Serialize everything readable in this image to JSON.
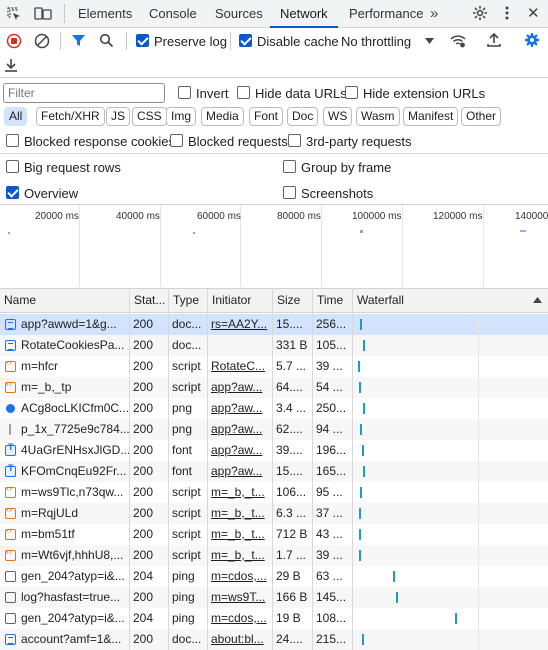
{
  "tabs": [
    "Elements",
    "Console",
    "Sources",
    "Network",
    "Performance"
  ],
  "active_tab": "Network",
  "toolbar": {
    "preserve_log": "Preserve log",
    "disable_cache": "Disable cache",
    "throttling": "No throttling"
  },
  "filter": {
    "placeholder": "Filter",
    "invert": "Invert",
    "hide_data_urls": "Hide data URLs",
    "hide_extension_urls": "Hide extension URLs"
  },
  "chips": [
    "All",
    "Fetch/XHR",
    "JS",
    "CSS",
    "Img",
    "Media",
    "Font",
    "Doc",
    "WS",
    "Wasm",
    "Manifest",
    "Other"
  ],
  "options": {
    "blocked_response_cookies": "Blocked response cookies",
    "blocked_requests": "Blocked requests",
    "third_party": "3rd-party requests",
    "big_rows": "Big request rows",
    "group_by_frame": "Group by frame",
    "overview": "Overview",
    "screenshots": "Screenshots"
  },
  "overview_ticks": [
    "20000 ms",
    "40000 ms",
    "60000 ms",
    "80000 ms",
    "100000 ms",
    "120000 ms",
    "140000"
  ],
  "columns": [
    "Name",
    "Stat...",
    "Type",
    "Initiator",
    "Size",
    "Time",
    "Waterfall"
  ],
  "rows": [
    {
      "name": "app?awwd=1&g...",
      "status": "200",
      "type": "doc...",
      "initiator": "rs=AA2Y...",
      "size": "15....",
      "time": "256...",
      "icon": "doc"
    },
    {
      "name": "RotateCookiesPa...",
      "status": "200",
      "type": "doc...",
      "initiator": "",
      "size": "331 B",
      "time": "105...",
      "icon": "doc"
    },
    {
      "name": "m=hfcr",
      "status": "200",
      "type": "script",
      "initiator": "RotateC...",
      "size": "5.7 ...",
      "time": "39 ...",
      "icon": "script"
    },
    {
      "name": "m=_b,_tp",
      "status": "200",
      "type": "script",
      "initiator": "app?aw...",
      "size": "64....",
      "time": "54 ...",
      "icon": "script"
    },
    {
      "name": "ACg8ocLKICfm0C...",
      "status": "200",
      "type": "png",
      "initiator": "app?aw...",
      "size": "3.4 ...",
      "time": "250...",
      "icon": "img"
    },
    {
      "name": "p_1x_7725e9c784...",
      "status": "200",
      "type": "png",
      "initiator": "app?aw...",
      "size": "62....",
      "time": "94 ...",
      "icon": "bar"
    },
    {
      "name": "4UaGrENHsxJlGD...",
      "status": "200",
      "type": "font",
      "initiator": "app?aw...",
      "size": "39....",
      "time": "196...",
      "icon": "font"
    },
    {
      "name": "KFOmCnqEu92Fr...",
      "status": "200",
      "type": "font",
      "initiator": "app?aw...",
      "size": "15....",
      "time": "165...",
      "icon": "font"
    },
    {
      "name": "m=ws9Tlc,n73qw...",
      "status": "200",
      "type": "script",
      "initiator": "m=_b,_t...",
      "size": "106...",
      "time": "95 ...",
      "icon": "script"
    },
    {
      "name": "m=RqjULd",
      "status": "200",
      "type": "script",
      "initiator": "m=_b,_t...",
      "size": "6.3 ...",
      "time": "37 ...",
      "icon": "script"
    },
    {
      "name": "m=bm51tf",
      "status": "200",
      "type": "script",
      "initiator": "m=_b,_t...",
      "size": "712 B",
      "time": "43 ...",
      "icon": "script"
    },
    {
      "name": "m=Wt6vjf,hhhU8,...",
      "status": "200",
      "type": "script",
      "initiator": "m=_b,_t...",
      "size": "1.7 ...",
      "time": "39 ...",
      "icon": "script"
    },
    {
      "name": "gen_204?atyp=i&...",
      "status": "204",
      "type": "ping",
      "initiator": "m=cdos,...",
      "size": "29 B",
      "time": "63 ...",
      "icon": "gray"
    },
    {
      "name": "log?hasfast=true...",
      "status": "200",
      "type": "ping",
      "initiator": "m=ws9T...",
      "size": "166 B",
      "time": "145...",
      "icon": "gray"
    },
    {
      "name": "gen_204?atyp=i&...",
      "status": "204",
      "type": "ping",
      "initiator": "m=cdos,...",
      "size": "19 B",
      "time": "108...",
      "icon": "gray"
    },
    {
      "name": "account?amf=1&...",
      "status": "200",
      "type": "doc...",
      "initiator": "about:bl...",
      "size": "24....",
      "time": "215...",
      "icon": "doc"
    }
  ],
  "colors": {
    "accent": "#0b57d0",
    "selected_row": "#d3e3fd",
    "waterfall": "#1a9fbf"
  }
}
